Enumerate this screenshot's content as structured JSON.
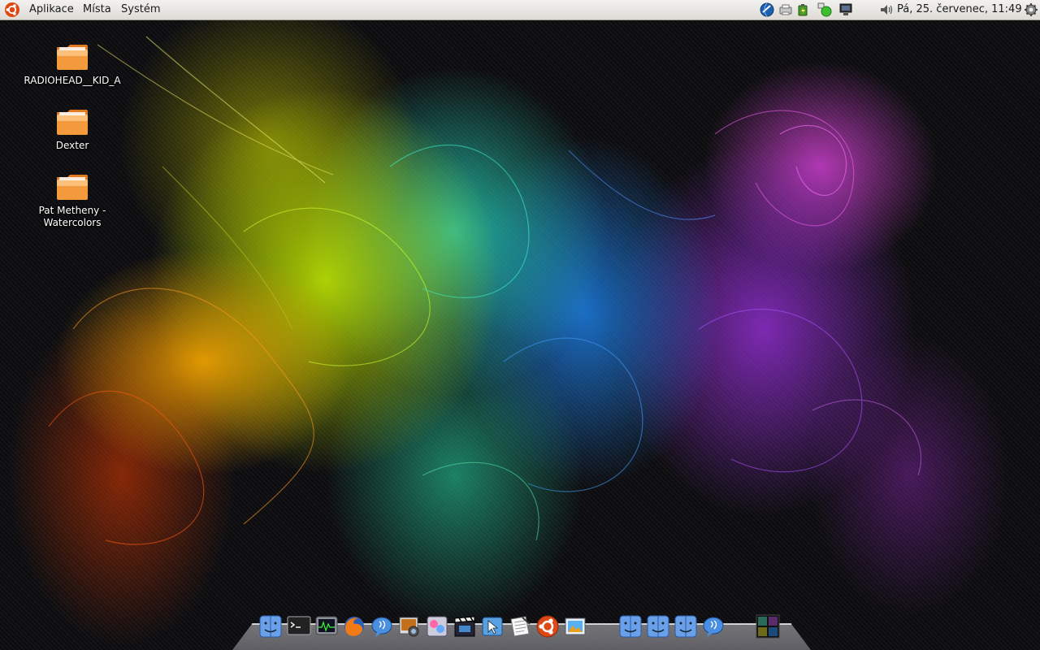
{
  "top_panel": {
    "menus": {
      "applications": "Aplikace",
      "places": "Místa",
      "system": "Systém"
    },
    "clock": "Pá, 25. červenec, 11:49",
    "tray_icons": [
      "network-globe-icon",
      "printer-icon",
      "battery-icon",
      "status-green-icon",
      "monitor-icon",
      "volume-icon",
      "settings-icon"
    ]
  },
  "desktop": {
    "icons": [
      {
        "label": "RADIOHEAD__KID_A",
        "icon": "folder-icon"
      },
      {
        "label": "Dexter",
        "icon": "folder-icon"
      },
      {
        "label": "Pat Metheny - Watercolors",
        "icon": "folder-icon"
      }
    ]
  },
  "dock": {
    "items": [
      "finder-icon",
      "terminal-icon",
      "system-monitor-icon",
      "firefox-icon",
      "messenger-icon",
      "photo-icon",
      "media-player-icon",
      "video-icon",
      "pointer-app-icon",
      "text-editor-icon",
      "ubuntu-icon",
      "image-viewer-icon",
      "finder-icon",
      "finder-icon",
      "finder-icon",
      "messenger-icon",
      "workspace-switcher-icon"
    ]
  },
  "colors": {
    "panel_top": "#f3f2f0",
    "panel_bottom": "#dedbd6",
    "folder_orange": "#f39a3c",
    "ubuntu_orange": "#dd4814"
  }
}
